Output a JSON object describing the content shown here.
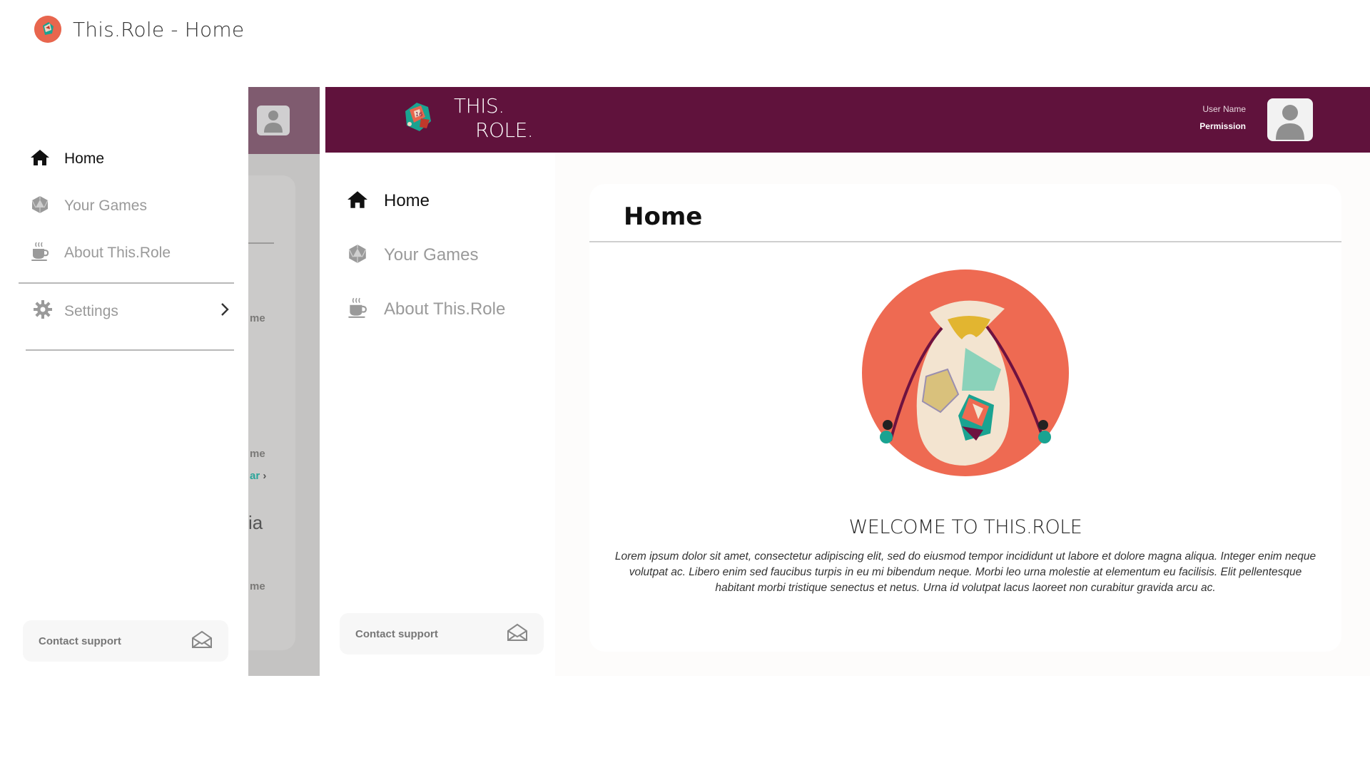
{
  "window": {
    "title": "This.Role - Home"
  },
  "colors": {
    "brand": "#60123c",
    "accent": "#e8664e",
    "teal": "#1aa391"
  },
  "mobile": {
    "nav": [
      {
        "label": "Home",
        "icon": "home-icon",
        "active": true
      },
      {
        "label": "Your Games",
        "icon": "d20-icon",
        "active": false
      },
      {
        "label": "About This.Role",
        "icon": "coffee-icon",
        "active": false
      }
    ],
    "settings_label": "Settings",
    "support_label": "Contact support",
    "dimmed_fragments": [
      "me",
      "me",
      "ar",
      "ia",
      "me"
    ]
  },
  "header": {
    "brand_line1": "THIS.",
    "brand_line2": "ROLE.",
    "user_name": "User Name",
    "permission": "Permission"
  },
  "sidebar": {
    "nav": [
      {
        "label": "Home",
        "icon": "home-icon",
        "active": true
      },
      {
        "label": "Your Games",
        "icon": "d20-icon",
        "active": false
      },
      {
        "label": "About This.Role",
        "icon": "coffee-icon",
        "active": false
      }
    ],
    "support_label": "Contact support"
  },
  "main": {
    "title": "Home",
    "welcome": "WELCOME TO THIS.ROLE",
    "body": "Lorem ipsum dolor sit amet, consectetur adipiscing elit, sed do eiusmod tempor incididunt ut labore et dolore magna aliqua. Integer enim neque volutpat ac. Libero enim sed faucibus turpis in eu mi bibendum neque. Morbi leo urna molestie at elementum eu facilisis. Elit pellentesque habitant morbi tristique senectus et netus. Urna id volutpat lacus laoreet non curabitur gravida arcu ac."
  }
}
